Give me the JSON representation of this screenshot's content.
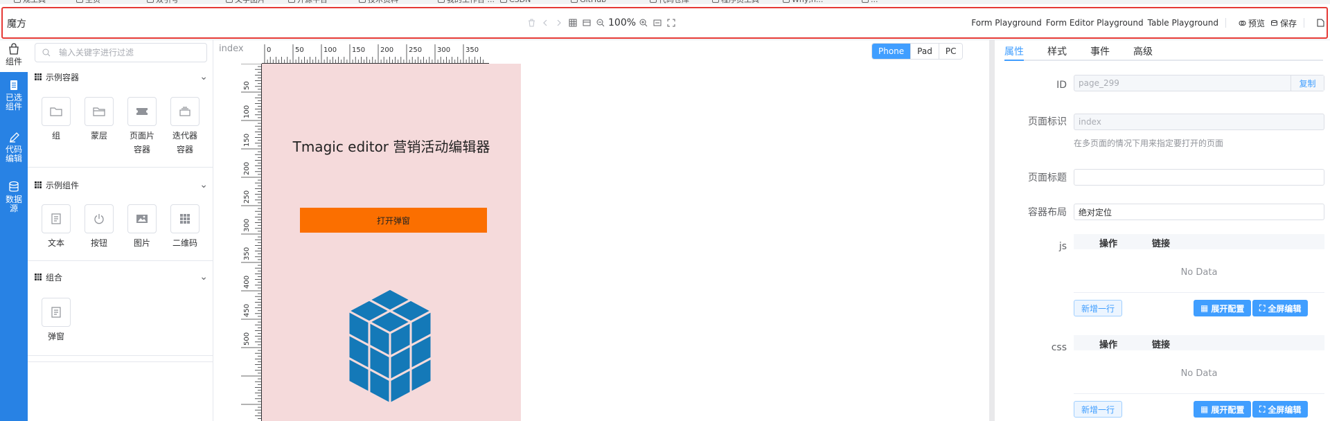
{
  "browser_bookmarks": [
    "规工具",
    "主页",
    "双引号",
    "文字图片",
    "开源平台",
    "技术资料",
    "我的工作台 ...",
    "CSDN",
    "GitHub",
    "代码仓库",
    "程序员工具",
    "Why,h...",
    "..."
  ],
  "toolbar": {
    "app_title": "魔方",
    "zoom": "100%",
    "links": [
      "Form Playground",
      "Form Editor Playground",
      "Table Playground"
    ],
    "preview_label": "预览",
    "save_label": "保存"
  },
  "left_nav": [
    {
      "label": "组件",
      "icon": "bag-icon"
    },
    {
      "label": "已选组件",
      "icon": "clipboard-icon"
    },
    {
      "label": "代码编辑",
      "icon": "pen-icon"
    },
    {
      "label": "数据源",
      "icon": "database-icon"
    }
  ],
  "components": {
    "search_placeholder": "输入关键字进行过滤",
    "groups": [
      {
        "title": "示例容器",
        "items": [
          {
            "label": "组",
            "icon": "folder-icon"
          },
          {
            "label": "蒙层",
            "icon": "folder-open-icon"
          },
          {
            "label": "页面片容器",
            "icon": "ticket-icon"
          },
          {
            "label": "迭代器容器",
            "icon": "stack-icon"
          }
        ]
      },
      {
        "title": "示例组件",
        "items": [
          {
            "label": "文本",
            "icon": "document-icon"
          },
          {
            "label": "按钮",
            "icon": "power-icon"
          },
          {
            "label": "图片",
            "icon": "image-icon"
          },
          {
            "label": "二维码",
            "icon": "qrcode-icon"
          }
        ]
      },
      {
        "title": "组合",
        "items": [
          {
            "label": "弹窗",
            "icon": "document-icon"
          }
        ]
      }
    ]
  },
  "workspace": {
    "page_label": "index",
    "devices": [
      "Phone",
      "Pad",
      "PC"
    ],
    "active_device": "Phone",
    "ruler_top_ticks": [
      "0",
      "50",
      "100",
      "150",
      "200",
      "250",
      "300",
      "350"
    ],
    "ruler_left_ticks": [
      "50",
      "100",
      "150",
      "200",
      "250",
      "300",
      "350",
      "400",
      "450",
      "500"
    ],
    "canvas": {
      "title": "Tmagic editor 营销活动编辑器",
      "button_label": "打开弹窗",
      "bg_color": "#f5dadb",
      "button_color": "#fb6f00",
      "cube_color": "#1479b8"
    }
  },
  "properties": {
    "tabs": [
      "属性",
      "样式",
      "事件",
      "高级"
    ],
    "active_tab": "属性",
    "id_label": "ID",
    "id_value": "page_299",
    "copy_label": "复制",
    "page_id_label": "页面标识",
    "page_id_value": "index",
    "page_id_hint": "在多页面的情况下用来指定要打开的页面",
    "page_title_label": "页面标题",
    "page_title_value": "",
    "layout_label": "容器布局",
    "layout_value": "绝对定位",
    "js_label": "js",
    "css_label": "css",
    "col_op": "操作",
    "col_link": "链接",
    "no_data": "No Data",
    "add_row": "新增一行",
    "expand_config": "展开配置",
    "fullscreen_edit": "全屏编辑"
  }
}
